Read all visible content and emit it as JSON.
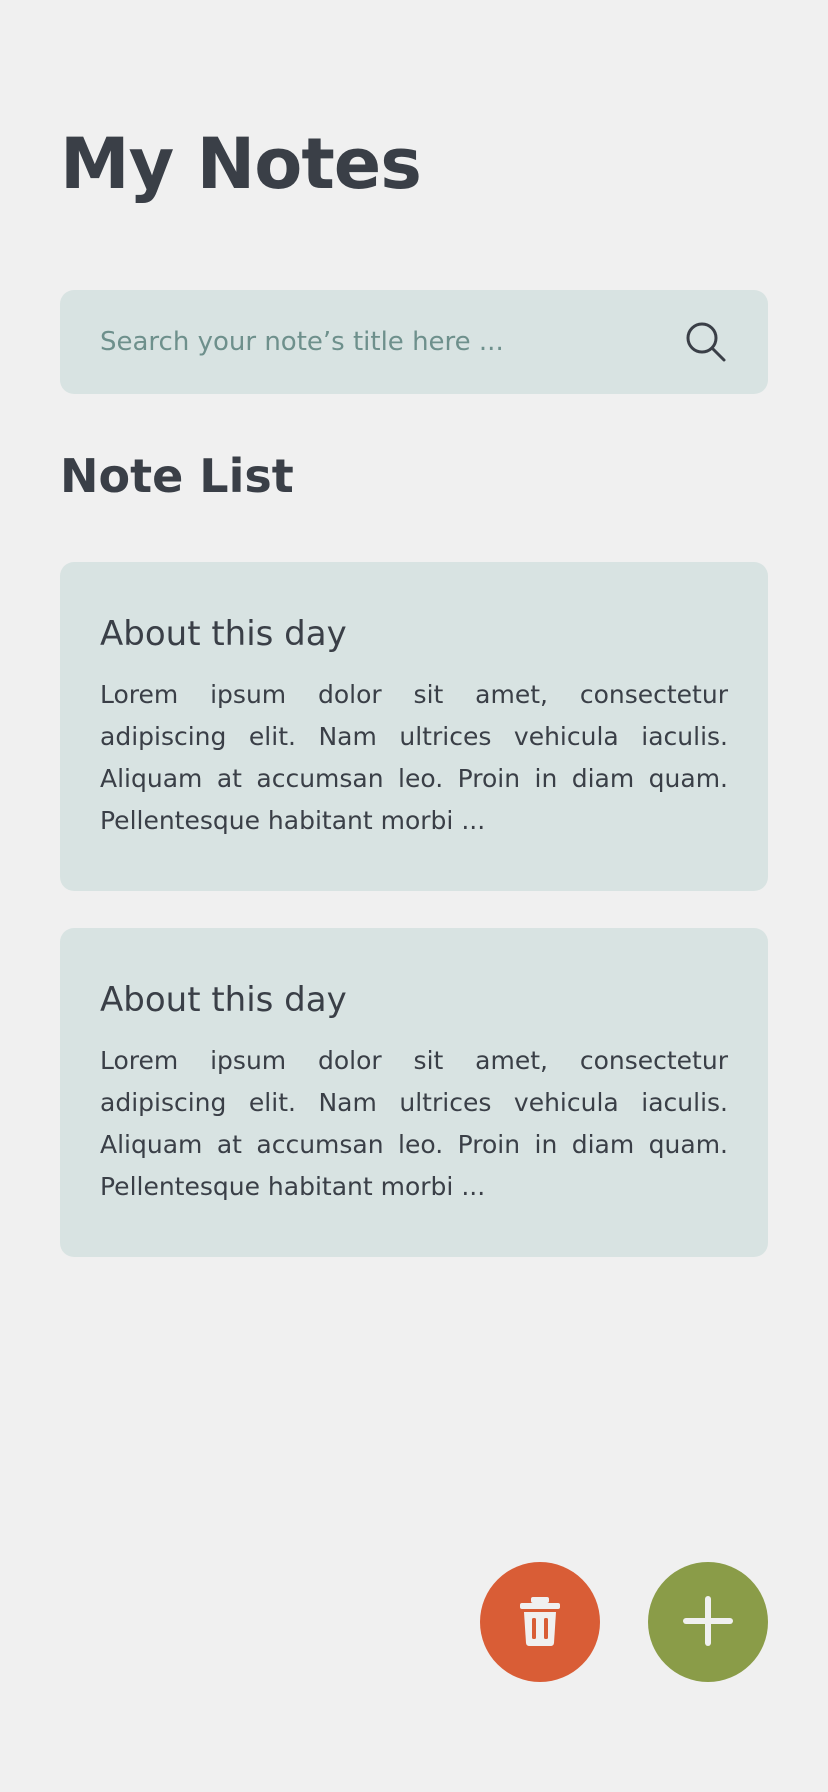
{
  "header": {
    "title": "My Notes"
  },
  "search": {
    "placeholder": "Search your note’s title here ...",
    "value": "",
    "icon": "search-icon"
  },
  "notes_section": {
    "heading": "Note List",
    "notes": [
      {
        "title": "About this day",
        "body": "Lorem ipsum dolor sit amet, consectetur adipiscing elit. Nam ultrices vehicula iaculis. Aliquam at accumsan leo. Proin in diam quam. Pellentesque habitant morbi ..."
      },
      {
        "title": "About this day",
        "body": "Lorem ipsum dolor sit amet, consectetur adipiscing elit. Nam ultrices vehicula iaculis. Aliquam at accumsan leo. Proin in diam quam. Pellentesque habitant morbi ..."
      }
    ]
  },
  "actions": {
    "delete": {
      "icon": "trash-icon",
      "color": "#d95d36"
    },
    "add": {
      "icon": "plus-icon",
      "color": "#8a9c48"
    }
  },
  "colors": {
    "background": "#f0f0f0",
    "card": "#d8e3e2",
    "text": "#3a3f47",
    "placeholder": "#6e908c"
  }
}
